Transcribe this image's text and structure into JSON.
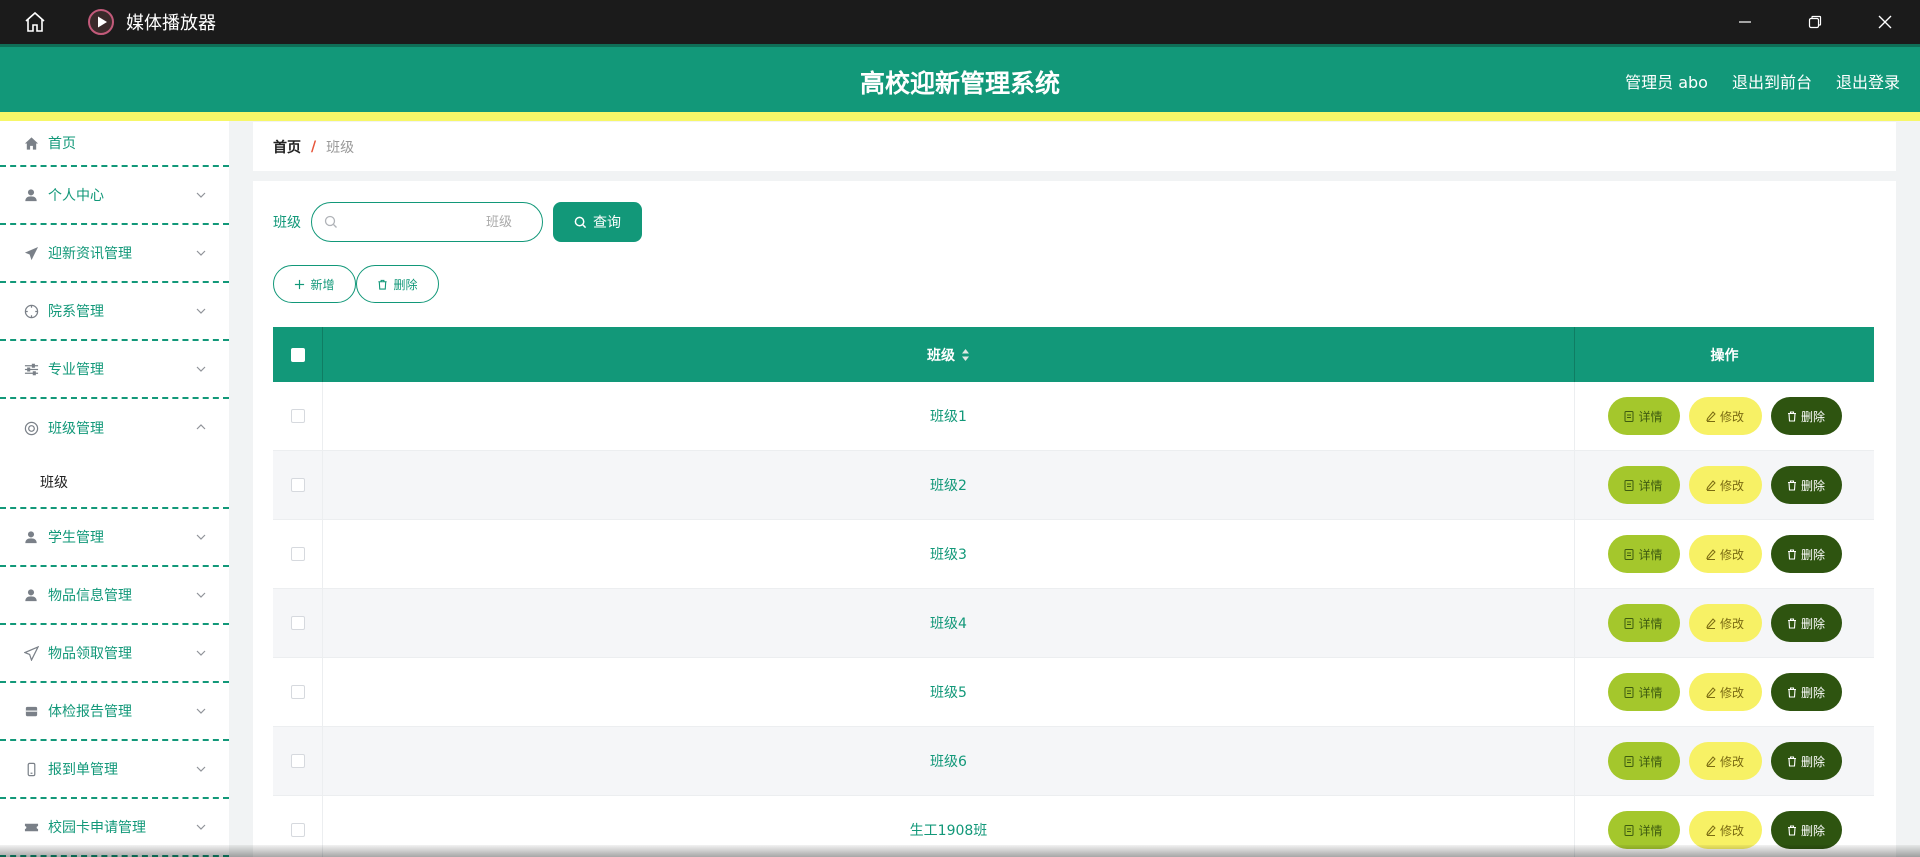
{
  "window": {
    "title": "媒体播放器"
  },
  "app": {
    "title": "高校迎新管理系统",
    "header_links": [
      "管理员 abo",
      "退出到前台",
      "退出登录"
    ]
  },
  "sidebar": {
    "home_label": "首页",
    "items": [
      {
        "label": "个人中心",
        "icon": "person-icon"
      },
      {
        "label": "迎新资讯管理",
        "icon": "send-icon"
      },
      {
        "label": "院系管理",
        "icon": "compass-icon"
      },
      {
        "label": "专业管理",
        "icon": "sliders-icon"
      },
      {
        "label": "班级管理",
        "icon": "lifebuoy-icon",
        "expanded": true,
        "submenu": [
          "班级"
        ]
      },
      {
        "label": "学生管理",
        "icon": "person-icon"
      },
      {
        "label": "物品信息管理",
        "icon": "person-icon"
      },
      {
        "label": "物品领取管理",
        "icon": "send-icon"
      },
      {
        "label": "体检报告管理",
        "icon": "box-icon"
      },
      {
        "label": "报到单管理",
        "icon": "phone-icon"
      },
      {
        "label": "校园卡申请管理",
        "icon": "ticket-icon"
      }
    ]
  },
  "breadcrumb": {
    "home": "首页",
    "separator": "/",
    "current": "班级"
  },
  "search": {
    "label": "班级",
    "placeholder": "班级",
    "button": "查询"
  },
  "actions": {
    "add": "新增",
    "delete": "删除"
  },
  "table": {
    "columns": [
      "班级",
      "操作"
    ],
    "rows": [
      "班级1",
      "班级2",
      "班级3",
      "班级4",
      "班级5",
      "班级6",
      "生工1908班"
    ],
    "row_actions": {
      "detail": "详情",
      "edit": "修改",
      "delete": "删除"
    }
  },
  "colors": {
    "primary": "#129879",
    "accent_yellow": "#f7f768",
    "detail_button": "#a4c72c",
    "edit_button": "#f7f165",
    "delete_button": "#2e5410"
  }
}
